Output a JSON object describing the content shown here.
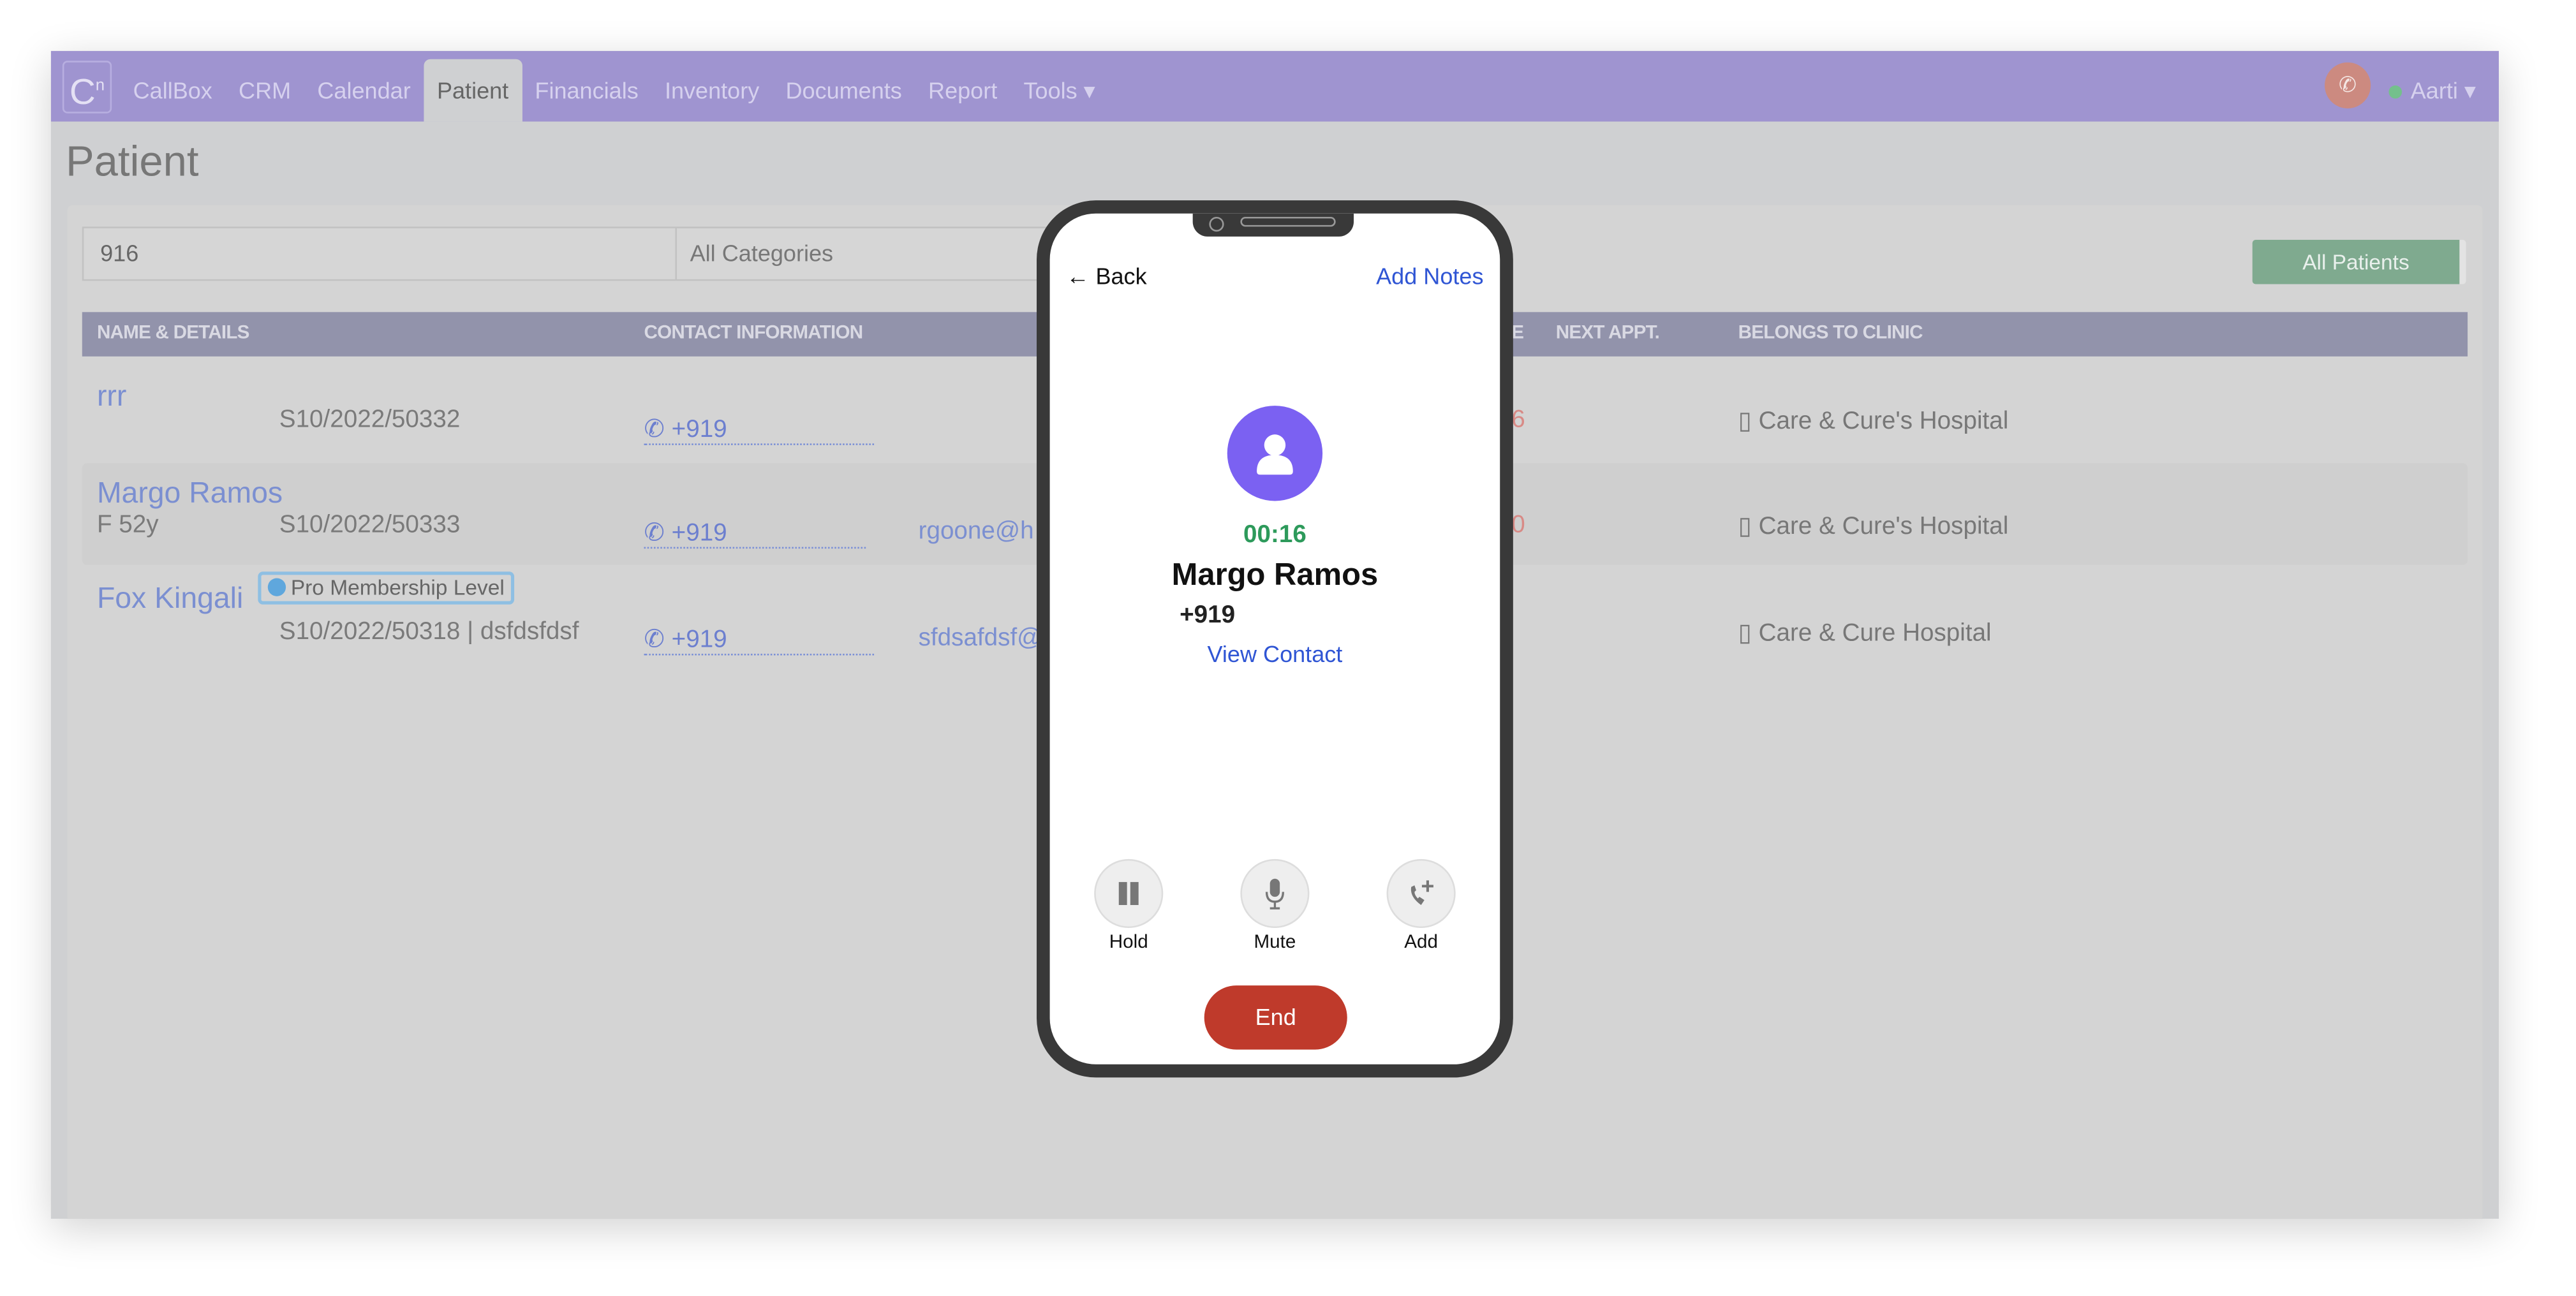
{
  "nav": {
    "logo": "C",
    "logo_sup": "n",
    "items": [
      "CallBox",
      "CRM",
      "Calendar",
      "Patient",
      "Financials",
      "Inventory",
      "Documents",
      "Report",
      "Tools ▾"
    ],
    "active": "Patient",
    "user": "Aarti ▾",
    "user_status_color": "#74c08c"
  },
  "page": {
    "title": "Patient"
  },
  "filters": {
    "search_value": "916",
    "category": "All Categories",
    "all_patients_label": "All Patients"
  },
  "table": {
    "headers": {
      "name": "NAME & DETAILS",
      "contact": "CONTACT INFORMATION",
      "partial": "E",
      "next_appt": "NEXT APPT.",
      "clinic": "BELONGS TO CLINIC"
    },
    "rows": [
      {
        "name": "rrr",
        "demo": "",
        "id": "S10/2022/50332",
        "phone": "+919",
        "email": "",
        "partial": "6",
        "clinic": "Care & Cure's Hospital"
      },
      {
        "name": "Margo Ramos",
        "demo": "F 52y",
        "id": "S10/2022/50333",
        "phone": "+919",
        "email": "rgoone@h",
        "partial": "0",
        "clinic": "Care & Cure's Hospital"
      },
      {
        "name": "Fox Kingali",
        "badge": "Pro Membership Level",
        "demo": "",
        "id": "S10/2022/50318 | dsfdsfdsf",
        "phone": "+919",
        "email": "sfdsafdsf@",
        "partial": "",
        "clinic": "Care & Cure Hospital"
      }
    ]
  },
  "call": {
    "back": "← Back",
    "add_notes": "Add Notes",
    "timer": "00:16",
    "name": "Margo Ramos",
    "number": "+919",
    "view_contact": "View Contact",
    "controls": [
      "Hold",
      "Mute",
      "Add"
    ],
    "end": "End",
    "colors": {
      "avatar": "#7b61f2",
      "end": "#bf3a2b",
      "timer": "#2d9a5b",
      "link": "#2f55d4"
    }
  }
}
